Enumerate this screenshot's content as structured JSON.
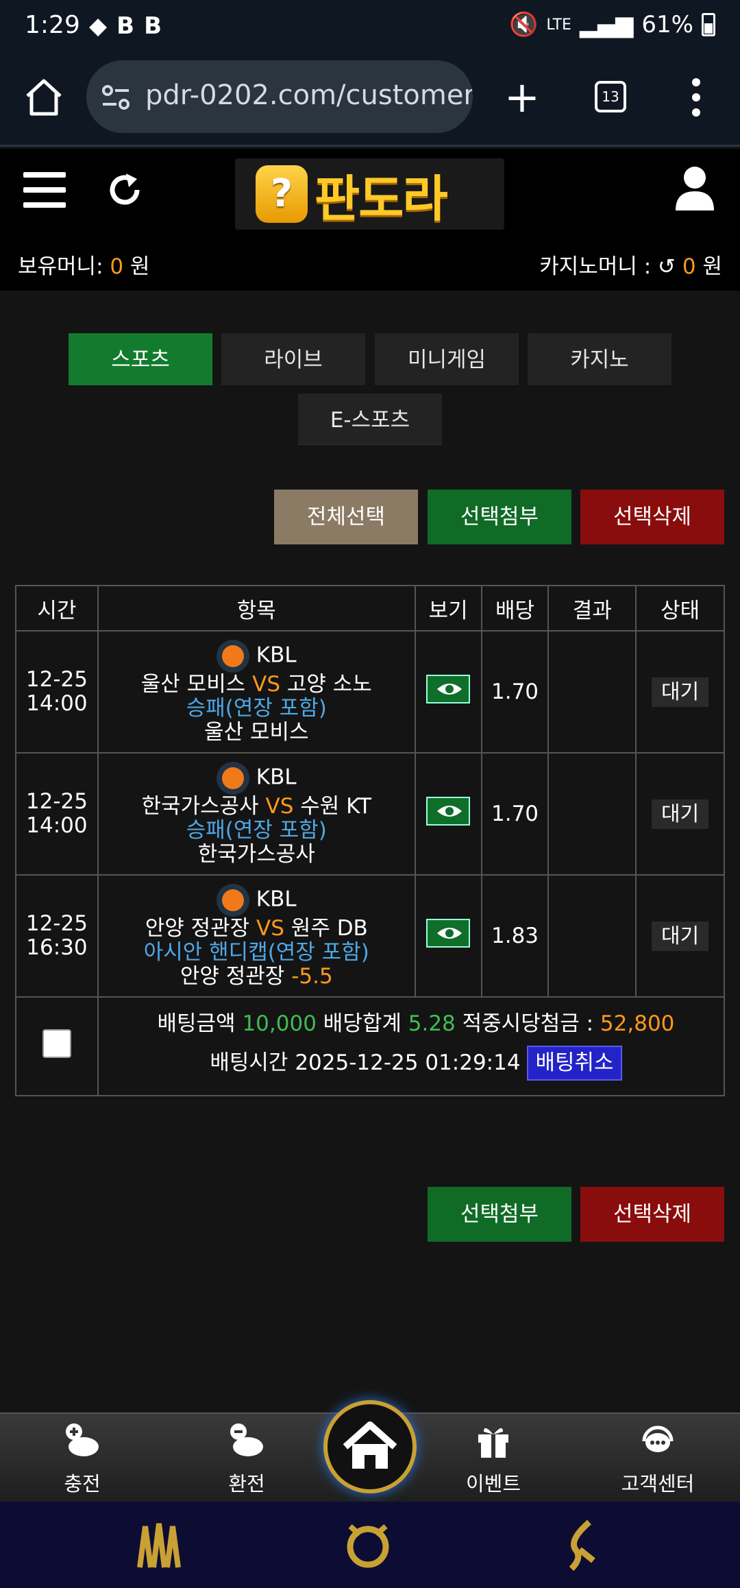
{
  "status_bar": {
    "time": "1:29",
    "icons": [
      "B",
      "B"
    ],
    "network": "LTE",
    "battery": "61%"
  },
  "browser": {
    "url": "pdr-0202.com/customer",
    "tab_count": "13"
  },
  "site": {
    "logo_text": "판도라",
    "holding_money_label": "보유머니:",
    "holding_money_value": "0",
    "holding_money_unit": "원",
    "casino_money_label": "카지노머니 :",
    "casino_money_value": "0",
    "casino_money_unit": "원"
  },
  "tabs": [
    "스포츠",
    "라이브",
    "미니게임",
    "카지노",
    "E-스포츠"
  ],
  "actions": {
    "select_all": "전체선택",
    "attach_selected": "선택첨부",
    "delete_selected": "선택삭제"
  },
  "table": {
    "headers": [
      "시간",
      "항목",
      "보기",
      "배당",
      "결과",
      "상태"
    ],
    "rows": [
      {
        "date": "12-25",
        "time": "14:00",
        "league": "KBL",
        "home": "울산 모비스",
        "vs": "VS",
        "away": "고양 소노",
        "market": "승패(연장 포함)",
        "pick": "울산 모비스",
        "handicap": "",
        "odds": "1.70",
        "result": "",
        "status": "대기"
      },
      {
        "date": "12-25",
        "time": "14:00",
        "league": "KBL",
        "home": "한국가스공사",
        "vs": "VS",
        "away": "수원 KT",
        "market": "승패(연장 포함)",
        "pick": "한국가스공사",
        "handicap": "",
        "odds": "1.70",
        "result": "",
        "status": "대기"
      },
      {
        "date": "12-25",
        "time": "16:30",
        "league": "KBL",
        "home": "안양 정관장",
        "vs": "VS",
        "away": "원주 DB",
        "market": "아시안 핸디캡(연장 포함)",
        "pick": "안양 정관장",
        "handicap": "-5.5",
        "odds": "1.83",
        "result": "",
        "status": "대기"
      }
    ],
    "summary": {
      "bet_amount_label": "배팅금액",
      "bet_amount": "10,000",
      "odds_total_label": "배당합계",
      "odds_total": "5.28",
      "expected_label": "적중시당첨금 :",
      "expected": "52,800",
      "bet_time_label": "배팅시간",
      "bet_time": "2025-12-25 01:29:14",
      "cancel_label": "배팅취소"
    }
  },
  "bottom_nav": {
    "charge": "충전",
    "exchange": "환전",
    "event": "이벤트",
    "support": "고객센터"
  },
  "colors": {
    "active_tab": "#127b2e",
    "accent_orange": "#ff9a1a",
    "odds_green": "#3fbe50",
    "market_blue": "#4ea8e6",
    "delete_red": "#8a0d0d"
  }
}
